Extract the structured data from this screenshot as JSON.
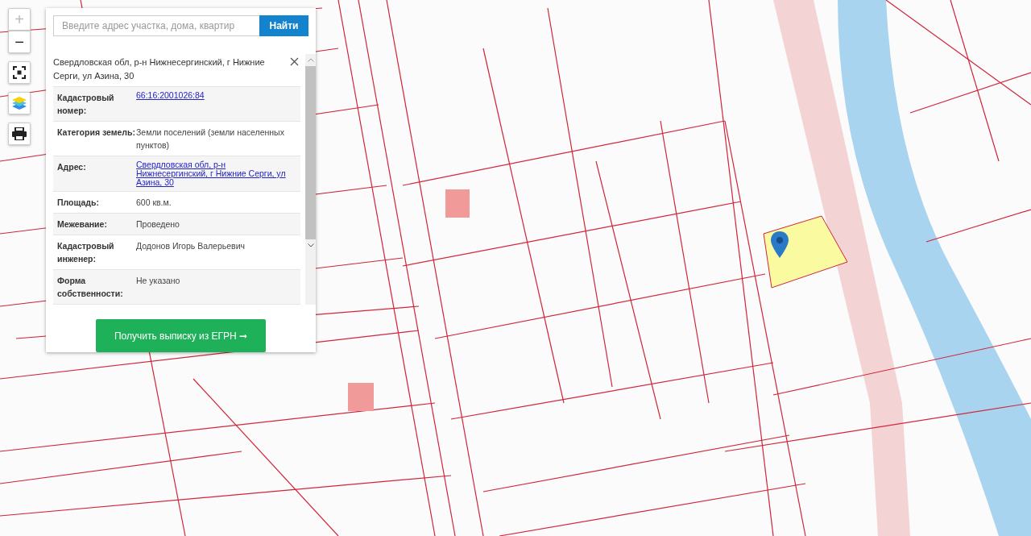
{
  "map_controls": [
    {
      "kind": "zoom-in",
      "label": "+",
      "disabled": true
    },
    {
      "kind": "zoom-out",
      "label": "−",
      "disabled": false
    },
    {
      "kind": "fit"
    },
    {
      "kind": "layers"
    },
    {
      "kind": "print"
    }
  ],
  "search": {
    "placeholder": "Введите адрес участка, дома, квартир",
    "button": "Найти"
  },
  "info_panel": {
    "title": "Свердловская обл, р-н Нижнесергинский, г Нижние Серги, ул Азина, 30",
    "rows": [
      {
        "label": "Кадастровый номер:",
        "value": "66:16:2001026:84",
        "kind": "link"
      },
      {
        "label": "Категория земель:",
        "value": "Земли поселений (земли населенных пунктов)",
        "kind": "text"
      },
      {
        "label": "Адрес:",
        "value": "Свердловская обл, р-н Нижнесергинский, г Нижние Серги, ул Азина, 30",
        "kind": "link"
      },
      {
        "label": "Площадь:",
        "value": "600 кв.м.",
        "kind": "text"
      },
      {
        "label": "Межевание:",
        "value": "Проведено",
        "kind": "text"
      },
      {
        "label": "Кадастровый инженер:",
        "value": "Додонов Игорь Валерьевич",
        "kind": "text"
      },
      {
        "label": "Форма собственности:",
        "value": "Не указано",
        "kind": "text"
      }
    ],
    "action": "Получить выписку из ЕГРН ➞"
  }
}
